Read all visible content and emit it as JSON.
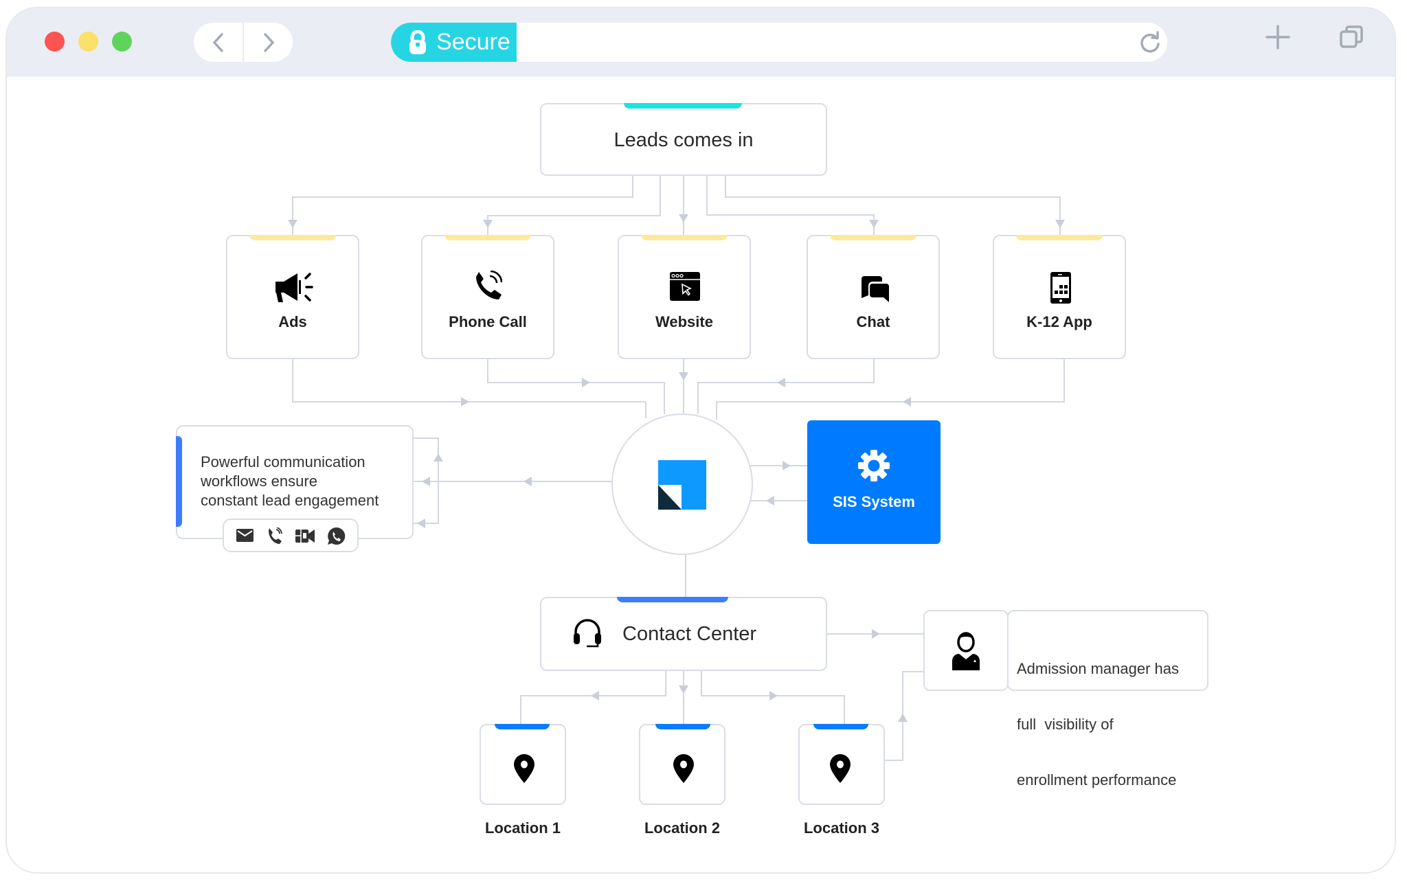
{
  "browser": {
    "traffic_lights": {
      "close": "#fc5453",
      "minimize": "#fbe06a",
      "maximize": "#5fd45c"
    },
    "nav": {
      "back_icon": "chevron-left-icon",
      "forward_icon": "chevron-right-icon"
    },
    "address_bar": {
      "secure_label": "Secure",
      "secure_color": "#25d5e4",
      "url": ""
    },
    "actions": {
      "new_tab_icon": "plus-icon",
      "tabs_icon": "tabs-icon",
      "reload_icon": "reload-icon"
    }
  },
  "diagram": {
    "source": {
      "label": "Leads comes in",
      "accent": "#1ae3e3"
    },
    "channels": [
      {
        "label": "Ads",
        "icon": "megaphone-icon"
      },
      {
        "label": "Phone Call",
        "icon": "phone-call-icon"
      },
      {
        "label": "Website",
        "icon": "website-icon"
      },
      {
        "label": "Chat",
        "icon": "chat-icon"
      },
      {
        "label": "K-12 App",
        "icon": "mobile-app-icon"
      }
    ],
    "channel_accent": "#fde99a",
    "hub": {
      "icon": "platform-logo-icon",
      "logo_colors": {
        "primary": "#0d99ff",
        "dark": "#0f2a3b"
      }
    },
    "sis": {
      "label": "SIS System",
      "icon": "gear-icon",
      "color": "#007bff"
    },
    "communication": {
      "text_lines": [
        "Powerful communication",
        "workflows ensure",
        "constant lead engagement"
      ],
      "accent": "#3d7cff",
      "channels": [
        {
          "icon": "email-icon"
        },
        {
          "icon": "phone-icon"
        },
        {
          "icon": "video-icon"
        },
        {
          "icon": "whatsapp-icon"
        }
      ]
    },
    "contact_center": {
      "label": "Contact Center",
      "icon": "headset-icon",
      "accent": "#3d7cff"
    },
    "admission": {
      "icon": "manager-icon",
      "text_lines": [
        "Admission manager has",
        "full  visibility of",
        "enrollment performance"
      ]
    },
    "locations": [
      {
        "label": "Location 1",
        "icon": "map-pin-icon"
      },
      {
        "label": "Location 2",
        "icon": "map-pin-icon"
      },
      {
        "label": "Location 3",
        "icon": "map-pin-icon"
      }
    ],
    "location_accent": "#0a7cff",
    "connector_color": "#d3d7df"
  }
}
